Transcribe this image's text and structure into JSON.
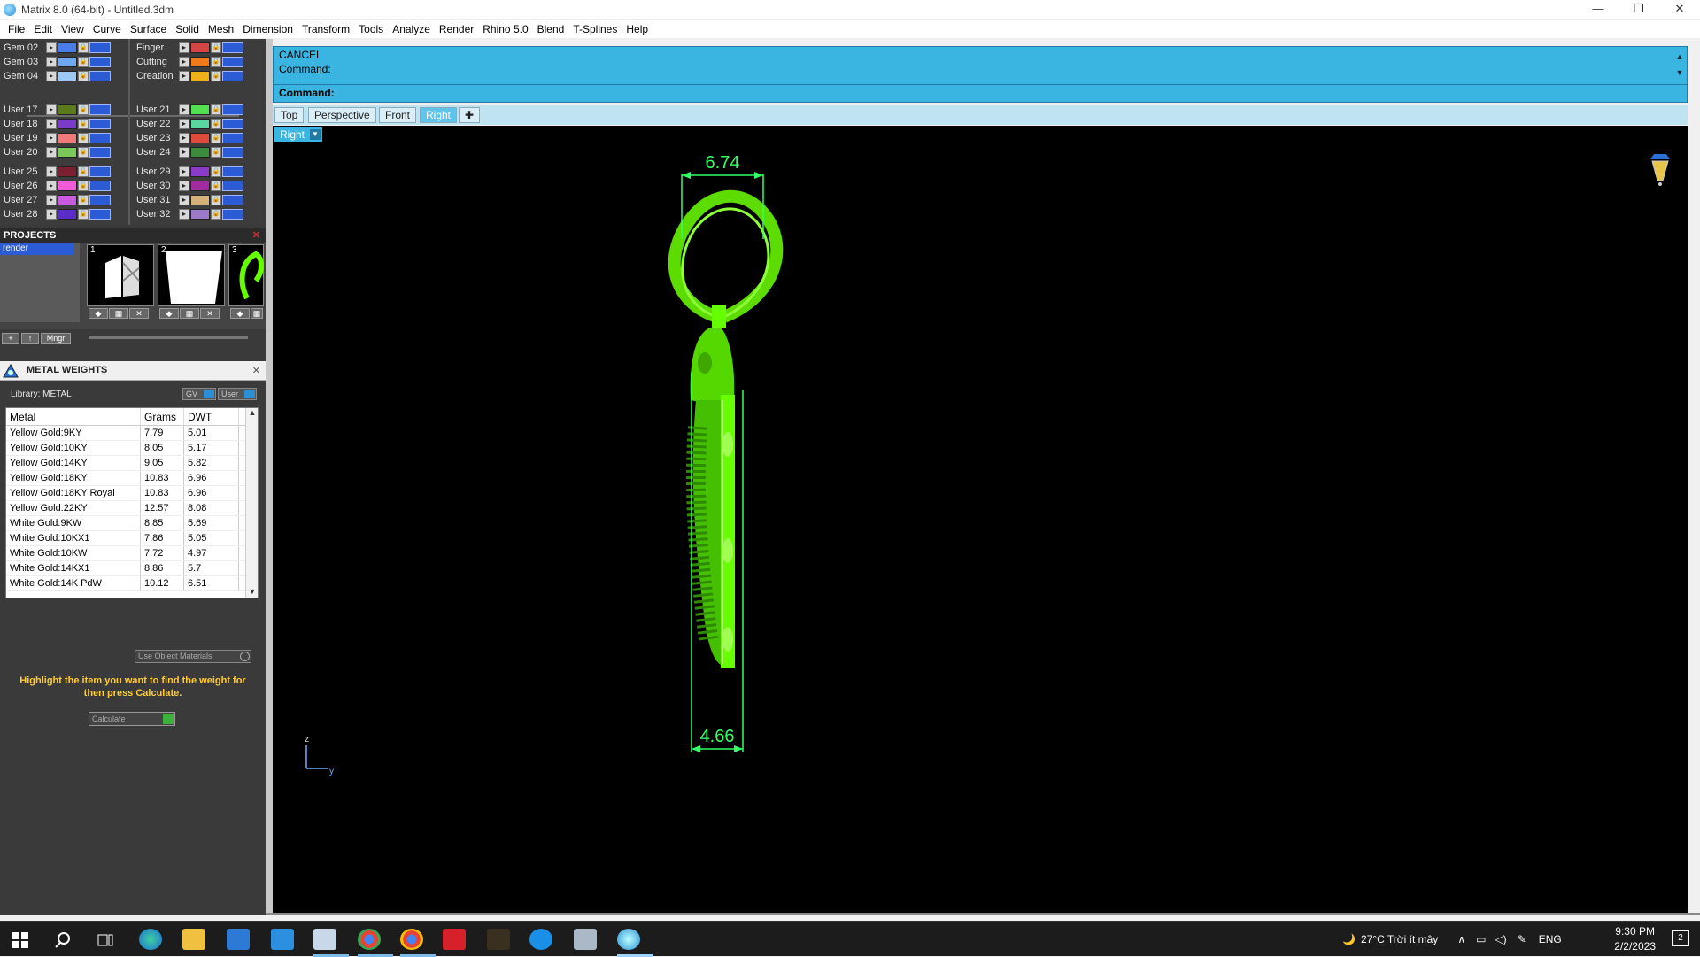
{
  "window": {
    "title": "Matrix 8.0 (64-bit) - Untitled.3dm",
    "minimize": "—",
    "maximize": "❐",
    "close": "✕"
  },
  "menu": [
    "File",
    "Edit",
    "View",
    "Curve",
    "Surface",
    "Solid",
    "Mesh",
    "Dimension",
    "Transform",
    "Tools",
    "Analyze",
    "Render",
    "Rhino 5.0",
    "Blend",
    "T-Splines",
    "Help"
  ],
  "layers": {
    "left_top": [
      {
        "name": "Gem 02",
        "color": "#4a7de8"
      },
      {
        "name": "Gem 03",
        "color": "#6fa8f0"
      },
      {
        "name": "Gem 04",
        "color": "#9cc9f5"
      }
    ],
    "right_top": [
      {
        "name": "Finger",
        "color": "#d64545"
      },
      {
        "name": "Cutting",
        "color": "#f07a1a"
      },
      {
        "name": "Creation",
        "color": "#f0b01a"
      }
    ],
    "left_mid": [
      {
        "name": "User 17",
        "color": "#5b7a1c"
      },
      {
        "name": "User 18",
        "color": "#7a3cc8"
      },
      {
        "name": "User 19",
        "color": "#f07a7a"
      },
      {
        "name": "User 20",
        "color": "#7ac85a"
      }
    ],
    "right_mid": [
      {
        "name": "User 21",
        "color": "#52e052"
      },
      {
        "name": "User 22",
        "color": "#5ad6a0"
      },
      {
        "name": "User 23",
        "color": "#e04a3c"
      },
      {
        "name": "User 24",
        "color": "#3c8a3c"
      }
    ],
    "left_bot": [
      {
        "name": "User 25",
        "color": "#7a2030"
      },
      {
        "name": "User 26",
        "color": "#f05ad6"
      },
      {
        "name": "User 27",
        "color": "#c85ae0"
      },
      {
        "name": "User 28",
        "color": "#5a2cc8"
      }
    ],
    "right_bot": [
      {
        "name": "User 29",
        "color": "#8a3cc8"
      },
      {
        "name": "User 30",
        "color": "#a02ca0"
      },
      {
        "name": "User 31",
        "color": "#d6b07a"
      },
      {
        "name": "User 32",
        "color": "#9c7ac8"
      }
    ]
  },
  "projects": {
    "header": "PROJECTS",
    "close": "✕",
    "selected_item": "render",
    "thumbs": [
      "1",
      "2",
      "3"
    ],
    "manager_label": "Mngr",
    "add_label": "+",
    "up_label": "↑"
  },
  "metal_weights": {
    "title": "METAL WEIGHTS",
    "close": "✕",
    "library": "Library: METAL",
    "gv_label": "GV",
    "user_label": "User",
    "columns": [
      "Metal",
      "Grams",
      "DWT"
    ],
    "rows": [
      [
        "Yellow Gold:9KY",
        "7.79",
        "5.01"
      ],
      [
        "Yellow Gold:10KY",
        "8.05",
        "5.17"
      ],
      [
        "Yellow Gold:14KY",
        "9.05",
        "5.82"
      ],
      [
        "Yellow Gold:18KY",
        "10.83",
        "6.96"
      ],
      [
        "Yellow Gold:18KY Royal",
        "10.83",
        "6.96"
      ],
      [
        "Yellow Gold:22KY",
        "12.57",
        "8.08"
      ],
      [
        "White Gold:9KW",
        "8.85",
        "5.69"
      ],
      [
        "White Gold:10KX1",
        "7.86",
        "5.05"
      ],
      [
        "White Gold:10KW",
        "7.72",
        "4.97"
      ],
      [
        "White Gold:14KX1",
        "8.86",
        "5.7"
      ],
      [
        "White Gold:14K PdW",
        "10.12",
        "6.51"
      ]
    ],
    "use_object_materials": "Use Object Materials",
    "hint": "Highlight the item you want to find the weight for then press Calculate.",
    "calculate": "Calculate"
  },
  "command": {
    "line1": "CANCEL",
    "line2": "Command:",
    "prompt": "Command:"
  },
  "view_tabs": [
    "Top",
    "Perspective",
    "Front",
    "Right"
  ],
  "active_view": "Right",
  "view_dropdown": "Right",
  "dimensions": {
    "top": "6.74",
    "bottom": "4.66"
  },
  "axis": {
    "z": "z",
    "y": "y"
  },
  "tray": {
    "weather": "27°C  Trời ít mây",
    "lang": "ENG",
    "time": "9:30 PM",
    "date": "2/2/2023",
    "notifications": "2"
  },
  "colors": {
    "accent": "#3ab4e1",
    "model": "#66ff00",
    "dimension": "#33ff66",
    "hint": "#ffcc33"
  }
}
